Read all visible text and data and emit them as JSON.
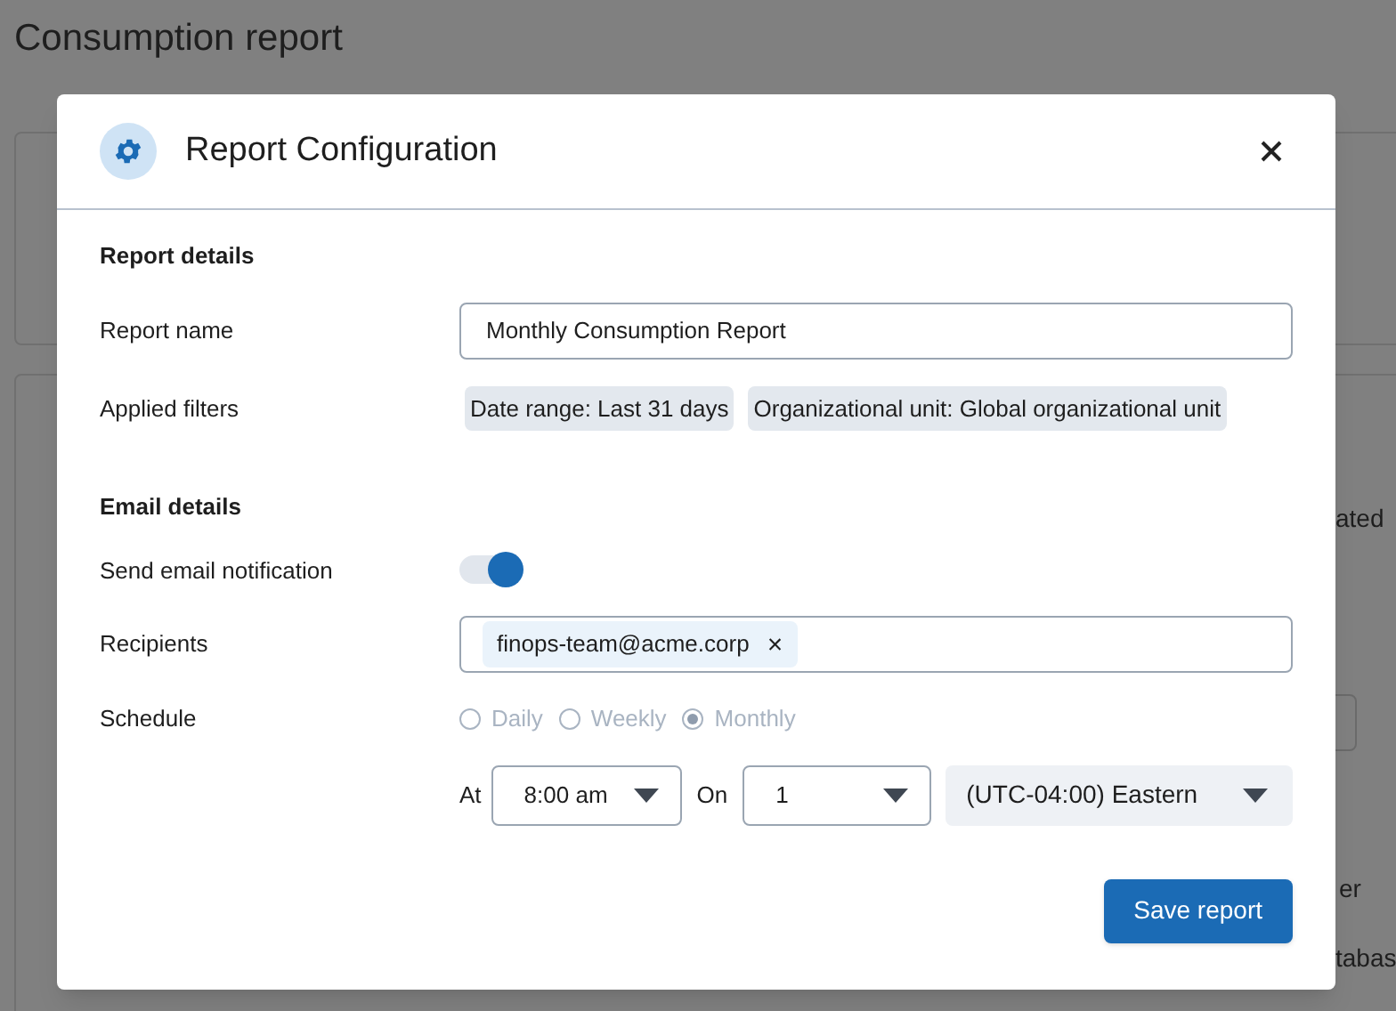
{
  "page": {
    "title": "Consumption report",
    "background_fragments": [
      "ated",
      "er",
      "tabas"
    ]
  },
  "dialog": {
    "title": "Report Configuration",
    "report_details": {
      "heading": "Report details",
      "name_label": "Report name",
      "name_value": "Monthly Consumption Report",
      "filters_label": "Applied filters",
      "filters": [
        "Date range: Last 31 days",
        "Organizational unit: Global organizational unit"
      ]
    },
    "email_details": {
      "heading": "Email details",
      "notify_label": "Send email notification",
      "notify_on": true,
      "recipients_label": "Recipients",
      "recipients": [
        "finops-team@acme.corp"
      ],
      "recipient_remove": "×",
      "schedule_label": "Schedule",
      "schedule_disabled": true,
      "frequencies": [
        {
          "label": "Daily",
          "selected": false
        },
        {
          "label": "Weekly",
          "selected": false
        },
        {
          "label": "Monthly",
          "selected": true
        }
      ],
      "at_label": "At",
      "time": "8:00 am",
      "on_label": "On",
      "day": "1",
      "timezone": "(UTC-04:00) Eastern"
    },
    "save_button": "Save report"
  }
}
